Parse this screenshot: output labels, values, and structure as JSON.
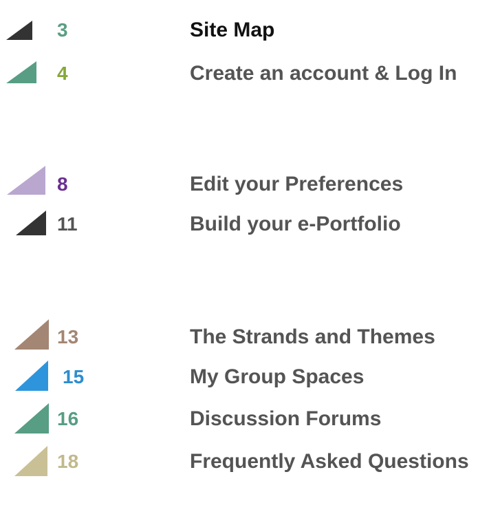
{
  "toc": {
    "entries": [
      {
        "page": "3",
        "title": "Site Map",
        "icon": "triangle-icon",
        "triangle_color": "#333333",
        "number_color": "#5a9e83",
        "title_color": "#111111"
      },
      {
        "page": "4",
        "title": "Create an account & Log In",
        "icon": "triangle-icon",
        "triangle_color": "#579e84",
        "number_color": "#85a83a",
        "title_color": "#545454"
      },
      {
        "page": "8",
        "title": "Edit your Preferences",
        "icon": "triangle-icon",
        "triangle_color": "#b9a7cf",
        "number_color": "#6b2f91",
        "title_color": "#545454"
      },
      {
        "page": "11",
        "title": "Build your e-Portfolio",
        "icon": "triangle-icon",
        "triangle_color": "#333333",
        "number_color": "#545454",
        "title_color": "#545454"
      },
      {
        "page": "13",
        "title": "The Strands and Themes",
        "icon": "triangle-icon",
        "triangle_color": "#a38673",
        "number_color": "#a38673",
        "title_color": "#545454"
      },
      {
        "page": "15",
        "title": "My Group Spaces",
        "icon": "triangle-icon",
        "triangle_color": "#2e95dc",
        "number_color": "#2e8dce",
        "title_color": "#545454"
      },
      {
        "page": "16",
        "title": "Discussion Forums",
        "icon": "triangle-icon",
        "triangle_color": "#579e84",
        "number_color": "#579e84",
        "title_color": "#545454"
      },
      {
        "page": "18",
        "title": "Frequently Asked Questions",
        "icon": "triangle-icon",
        "triangle_color": "#c9c095",
        "number_color": "#c1b98c",
        "title_color": "#545454"
      }
    ]
  }
}
